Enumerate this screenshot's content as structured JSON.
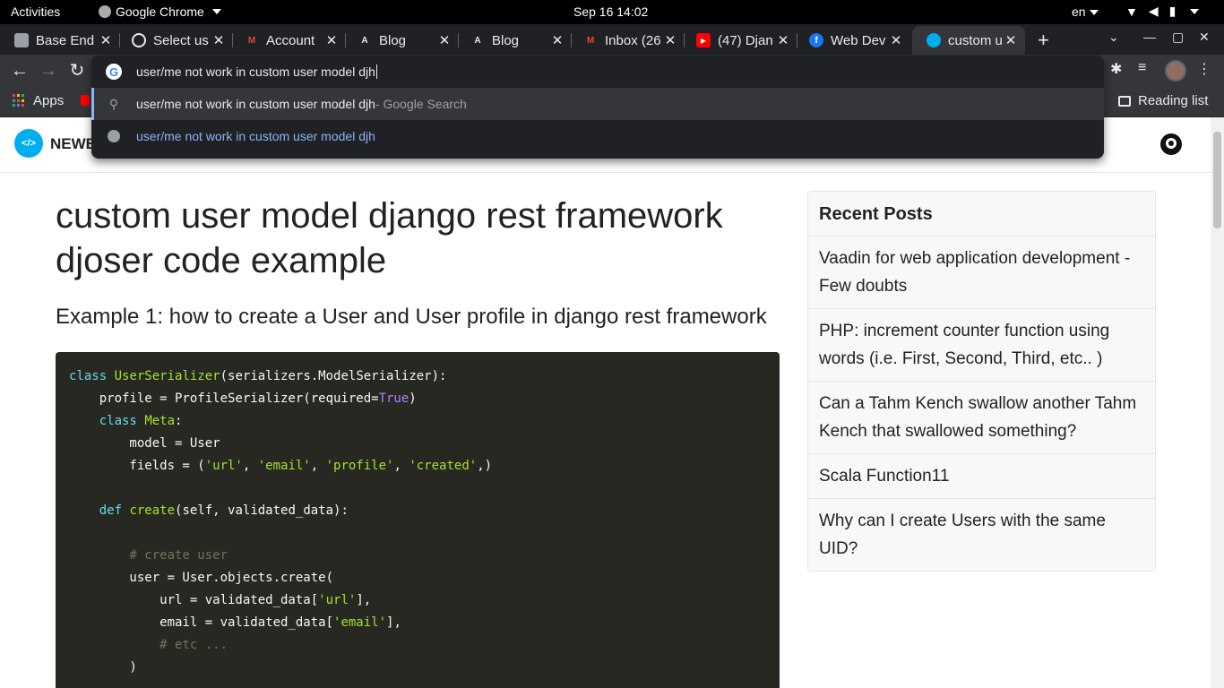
{
  "system_bar": {
    "activities": "Activities",
    "app_name": "Google Chrome",
    "clock": "Sep 16  14:02",
    "language": "en"
  },
  "tabs": [
    {
      "title": "Base End",
      "icon": "doc-icon",
      "color": "#9aa0a6"
    },
    {
      "title": "Select us",
      "icon": "globe-icon",
      "color": "#e8eaed"
    },
    {
      "title": "Account",
      "icon": "gmail-icon",
      "color": "#ea4335"
    },
    {
      "title": "Blog",
      "icon": "a-icon",
      "color": "#e8eaed"
    },
    {
      "title": "Blog",
      "icon": "a-icon",
      "color": "#e8eaed"
    },
    {
      "title": "Inbox (26",
      "icon": "gmail-icon",
      "color": "#ea4335"
    },
    {
      "title": "(47) Djan",
      "icon": "youtube-icon",
      "color": "#ff0000"
    },
    {
      "title": "Web Dev",
      "icon": "facebook-icon",
      "color": "#1877f2"
    },
    {
      "title": "custom u",
      "icon": "newbedev-icon",
      "color": "#00aeef",
      "active": true
    }
  ],
  "omnibox": {
    "query": "user/me not work in custom user model djh",
    "suggestions": [
      {
        "text": "user/me not work in custom user model djh",
        "sub": " - Google Search",
        "type": "search"
      },
      {
        "text": "user/me not work in custom user model djh",
        "sub": "",
        "type": "url"
      }
    ]
  },
  "bookmarks": {
    "apps_label": "Apps",
    "reading_list": "Reading list"
  },
  "site": {
    "brand": "NEWB",
    "title": "custom user model django rest framework djoser code example",
    "example_title": "Example 1: how to create a User and User profile in django rest framework"
  },
  "sidebar": {
    "heading": "Recent Posts",
    "posts": [
      "Vaadin for web application development - Few doubts",
      "PHP: increment counter function using words (i.e. First, Second, Third, etc.. )",
      "Can a Tahm Kench swallow another Tahm Kench that swallowed something?",
      "Scala Function11",
      "Why can I create Users with the same UID?"
    ]
  }
}
